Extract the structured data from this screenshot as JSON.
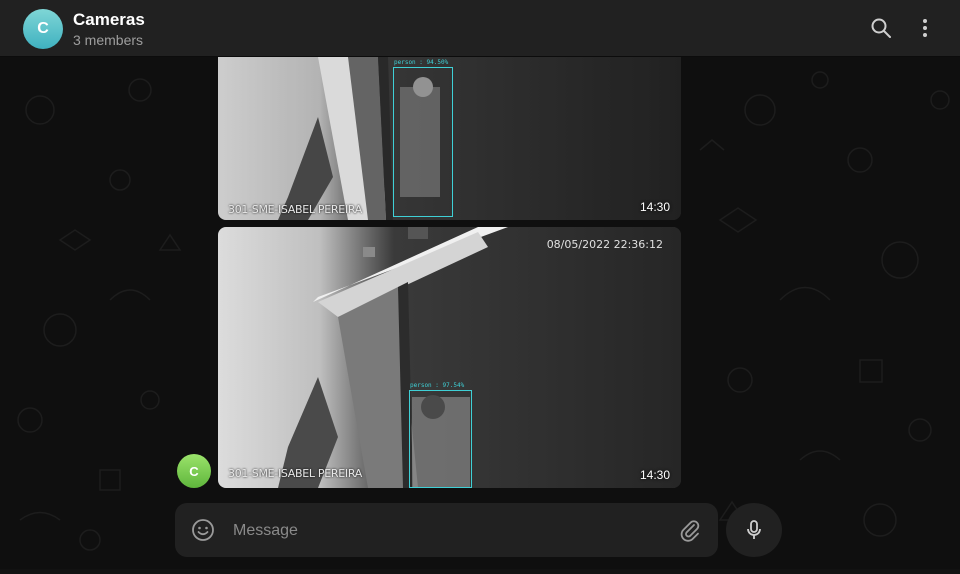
{
  "header": {
    "avatar_letter": "C",
    "title": "Cameras",
    "subtitle": "3 members",
    "icons": [
      "search-icon",
      "more-vertical-icon"
    ]
  },
  "messages": [
    {
      "camera_label": "301-SME-ISABEL PEREIRA",
      "detection_label": "person : 94.50%",
      "time": "14:30"
    },
    {
      "camera_label": "301-SME-ISABEL PEREIRA",
      "detection_label": "person : 97.54%",
      "timestamp": "08/05/2022 22:36:12",
      "time": "14:30",
      "sender_avatar_letter": "C"
    }
  ],
  "composer": {
    "placeholder": "Message",
    "icons": [
      "emoji-icon",
      "attach-icon",
      "microphone-icon"
    ]
  },
  "colors": {
    "header_bg": "#212121",
    "chat_bg": "#0f0f0f",
    "detection": "#3fd0d6",
    "group_avatar": "#4fbfc9",
    "sender_avatar": "#74c74a"
  }
}
